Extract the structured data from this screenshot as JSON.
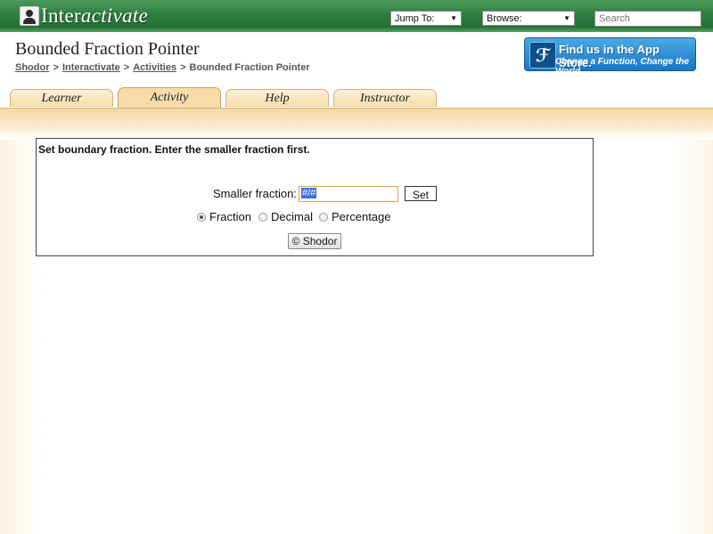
{
  "topbar": {
    "logo_text_inter": "Inter",
    "logo_text_activate": "activate",
    "jump_to_label": "Jump To:",
    "browse_label": "Browse:",
    "search_placeholder": "Search",
    "icon_logo": "reader-book-icon",
    "icon_dropdown": "chevron-down-icon",
    "bar_color": "#2f7f42"
  },
  "header": {
    "title": "Bounded Fraction Pointer",
    "breadcrumb": {
      "items": [
        "Shodor",
        "Interactivate",
        "Activities"
      ],
      "separator": ">",
      "current": "Bounded Fraction Pointer"
    },
    "app_store": {
      "line1": "Find us in the App Store.",
      "line2": "Change a Function, Change the World",
      "icon": "app-store-logo-icon",
      "color": "#1a78c4"
    }
  },
  "tabs": [
    {
      "label": "Learner",
      "active": false
    },
    {
      "label": "Activity",
      "active": true
    },
    {
      "label": "Help",
      "active": false
    },
    {
      "label": "Instructor",
      "active": false
    }
  ],
  "applet": {
    "instruction": "Set boundary fraction. Enter the smaller fraction first.",
    "smaller_label": "Smaller fraction:",
    "input_value": "#/#",
    "set_label": "Set",
    "radio_options": [
      {
        "label": "Fraction",
        "selected": true
      },
      {
        "label": "Decimal",
        "selected": false
      },
      {
        "label": "Percentage",
        "selected": false
      }
    ],
    "copyright_label": "© Shodor",
    "accent_color": "#f7dcaa"
  }
}
